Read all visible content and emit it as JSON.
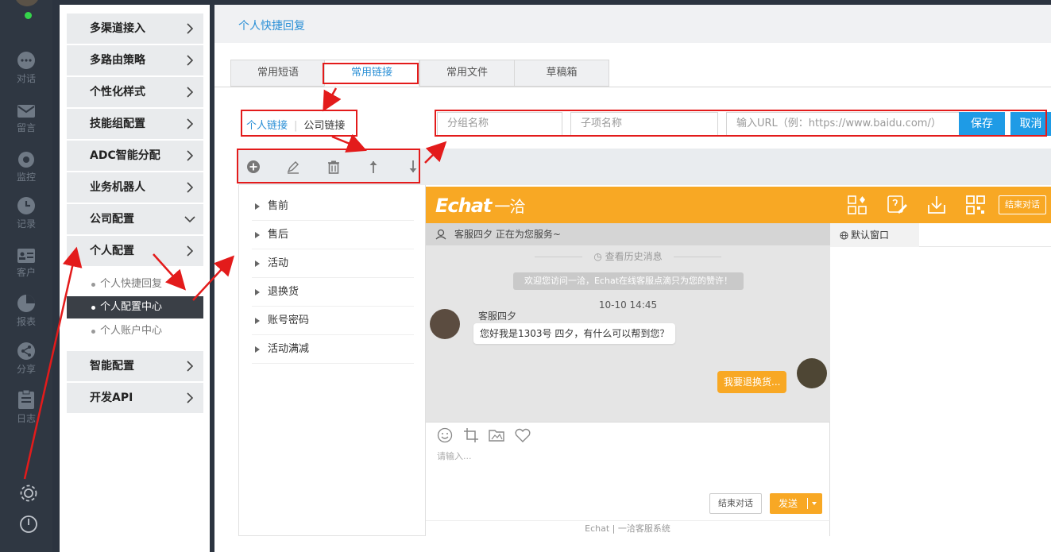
{
  "rail": {
    "items": [
      {
        "icon": "chat-bubble-icon",
        "label": "对话"
      },
      {
        "icon": "mail-icon",
        "label": "留言"
      },
      {
        "icon": "eye-icon",
        "label": "监控"
      },
      {
        "icon": "clock-icon",
        "label": "记录"
      },
      {
        "icon": "id-card-icon",
        "label": "客户"
      },
      {
        "icon": "pie-chart-icon",
        "label": "报表"
      },
      {
        "icon": "share-icon",
        "label": "分享"
      },
      {
        "icon": "clipboard-icon",
        "label": "日志"
      }
    ],
    "status_color": "#35d44b"
  },
  "menu": {
    "items": [
      {
        "label": "多渠道接入"
      },
      {
        "label": "多路由策略"
      },
      {
        "label": "个性化样式"
      },
      {
        "label": "技能组配置"
      },
      {
        "label": "ADC智能分配"
      },
      {
        "label": "业务机器人"
      },
      {
        "label": "公司配置"
      },
      {
        "label": "个人配置"
      },
      {
        "label": "智能配置"
      },
      {
        "label": "开发API"
      }
    ],
    "sub_items": [
      {
        "label": "个人快捷回复"
      },
      {
        "label": "个人配置中心"
      },
      {
        "label": "个人账户中心"
      }
    ]
  },
  "page": {
    "title": "个人快捷回复",
    "tabs": [
      {
        "label": "常用短语"
      },
      {
        "label": "常用链接"
      },
      {
        "label": "常用文件"
      },
      {
        "label": "草稿箱"
      }
    ],
    "switch": {
      "personal": "个人链接",
      "company": "公司链接"
    },
    "form": {
      "group_placeholder": "分组名称",
      "child_placeholder": "子项名称",
      "url_placeholder": "输入URL（例：https://www.baidu.com/）",
      "save": "保存",
      "cancel": "取消"
    },
    "tree": [
      {
        "label": "售前"
      },
      {
        "label": "售后"
      },
      {
        "label": "活动"
      },
      {
        "label": "退换货"
      },
      {
        "label": "账号密码"
      },
      {
        "label": "活动满减"
      }
    ]
  },
  "chat": {
    "logo": "Echat",
    "logo_cn": "一洽",
    "end_chat_top": "结束对话",
    "status": "客服四夕 正在为您服务~",
    "history": "查看历史消息",
    "welcome": "欢迎您访问一洽，Echat在线客服点滴只为您的赞许！",
    "time": "10-10 14:45",
    "agent_name": "客服四夕",
    "agent_msg": "您好我是1303号 四夕，有什么可以帮到您？",
    "user_msg": "我要退换货...",
    "placeholder": "请输入...",
    "end_btn": "结束对话",
    "send_btn": "发送",
    "footer": "Echat | 一洽客服系统",
    "side_tab": "默认窗口",
    "accent": "#f8a824"
  },
  "colors": {
    "link_blue": "#2a8fd6",
    "button_blue": "#1e9be6",
    "annotation_red": "#e31b1b"
  }
}
